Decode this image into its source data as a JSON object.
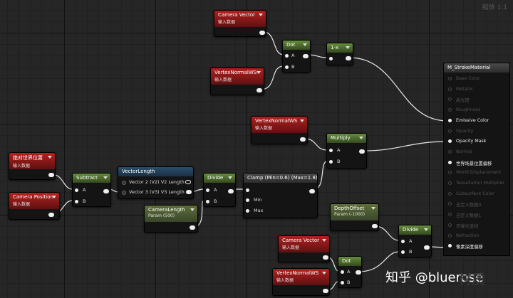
{
  "zoom_label": "缩放 1:1",
  "watermark": {
    "text": "知乎 @bluerose",
    "corner_text": "材质"
  },
  "nodes": {
    "camera_vector_1": {
      "title": "Camera Vector",
      "subtitle": "输入数据"
    },
    "dot_1": {
      "title": "Dot",
      "pin_a": "A",
      "pin_b": "B"
    },
    "one_minus": {
      "title": "1-x"
    },
    "vertex_normal_1": {
      "title": "VertexNormalWS",
      "subtitle": "输入数据"
    },
    "vertex_normal_2": {
      "title": "VertexNormalWS",
      "subtitle": "输入数据"
    },
    "multiply": {
      "title": "Multiply",
      "pin_a": "A",
      "pin_b": "B"
    },
    "absolute_world_pos": {
      "title": "绝对世界位置",
      "subtitle": "输入数据"
    },
    "camera_position": {
      "title": "Camera Position",
      "subtitle": "输入数据"
    },
    "subtract": {
      "title": "Subtract",
      "pin_a": "A",
      "pin_b": "B"
    },
    "vector_length": {
      "title": "VectorLength",
      "row1": "Vector 2 (V2) V2 Length",
      "row2": "Vector 3 (V3) V3 Length"
    },
    "camera_length": {
      "title": "CameraLength",
      "subtitle": "Param (500)"
    },
    "divide_1": {
      "title": "Divide",
      "pin_a": "A",
      "pin_b": "B"
    },
    "clamp": {
      "title": "Clamp (Min=0.6) (Max=1.8)",
      "pin_min": "Min",
      "pin_max": "Max"
    },
    "depth_offset": {
      "title": "DepthOffset",
      "subtitle": "Param (-1000)"
    },
    "divide_2": {
      "title": "Divide",
      "pin_a": "A",
      "pin_b": "B"
    },
    "camera_vector_2": {
      "title": "Camera Vector",
      "subtitle": "输入数据"
    },
    "dot_2": {
      "title": "Dot",
      "pin_a": "A",
      "pin_b": "B"
    },
    "vertex_normal_3": {
      "title": "VertexNormalWS",
      "subtitle": "输入数据"
    }
  },
  "material": {
    "title": "M_StrokeMaterial",
    "inputs": [
      {
        "label": "Base Color",
        "active": false
      },
      {
        "label": "Metallic",
        "active": false
      },
      {
        "label": "高光度",
        "active": false
      },
      {
        "label": "Roughness",
        "active": false
      },
      {
        "label": "Emissive Color",
        "active": true
      },
      {
        "label": "Opacity",
        "active": false
      },
      {
        "label": "Opacity Mask",
        "active": true
      },
      {
        "label": "Normal",
        "active": false
      },
      {
        "label": "世界场景位置偏移",
        "active": true
      },
      {
        "label": "World Displacement",
        "active": false
      },
      {
        "label": "Tessellation Multiplier",
        "active": false
      },
      {
        "label": "Subsurface Color",
        "active": false
      },
      {
        "label": "自定义数据0",
        "active": false
      },
      {
        "label": "自定义数据1",
        "active": false
      },
      {
        "label": "环境光遮挡",
        "active": false
      },
      {
        "label": "Refraction",
        "active": false
      },
      {
        "label": "像素深度偏移",
        "active": true
      }
    ]
  }
}
